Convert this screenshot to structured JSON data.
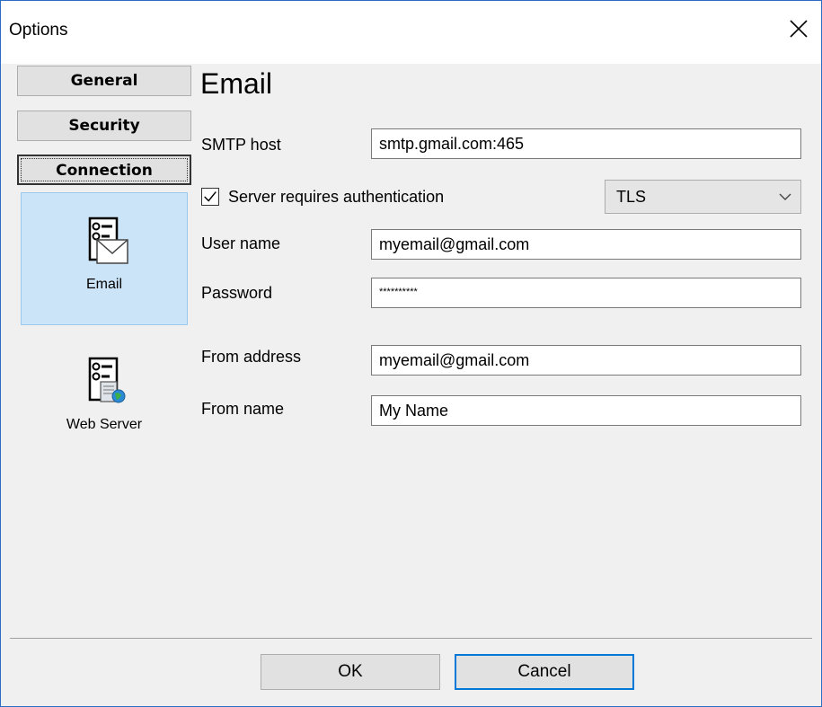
{
  "window": {
    "title": "Options"
  },
  "nav": {
    "buttons": [
      "General",
      "Security",
      "Connection"
    ],
    "tiles": [
      {
        "label": "Email",
        "icon": "email-settings-icon",
        "selected": true
      },
      {
        "label": "Web Server",
        "icon": "web-server-icon",
        "selected": false
      }
    ]
  },
  "email": {
    "heading": "Email",
    "smtp_host_label": "SMTP host",
    "smtp_host_value": "smtp.gmail.com:465",
    "auth_label": "Server requires authentication",
    "auth_checked": true,
    "security_value": "TLS",
    "username_label": "User name",
    "username_value": "myemail@gmail.com",
    "password_label": "Password",
    "password_value": "**********",
    "from_address_label": "From address",
    "from_address_value": "myemail@gmail.com",
    "from_name_label": "From name",
    "from_name_value": "My Name"
  },
  "footer": {
    "ok_label": "OK",
    "cancel_label": "Cancel"
  },
  "colors": {
    "accent": "#0078d7",
    "selection": "#cce4f7",
    "window_border": "#2b6cc4"
  }
}
